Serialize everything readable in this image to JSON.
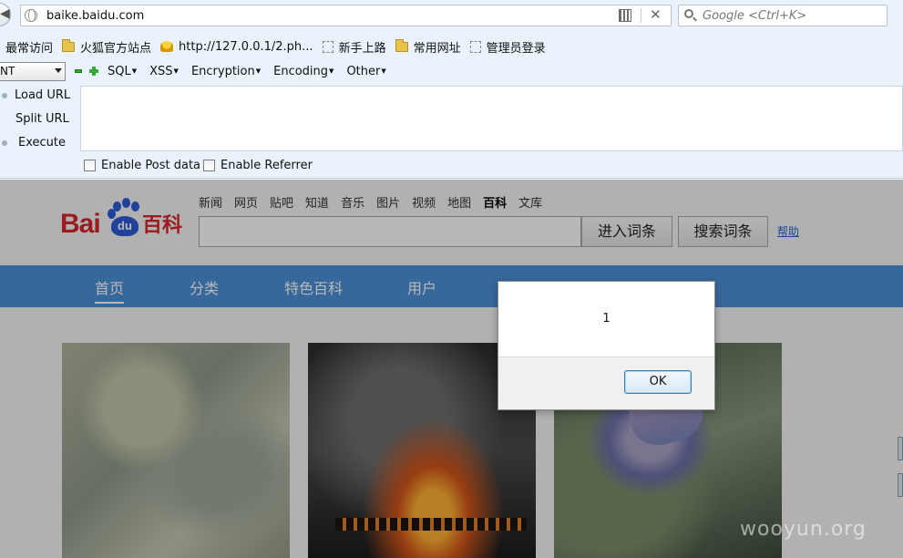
{
  "browser": {
    "url_host": "baike.baidu.com",
    "search_placeholder": "Google <Ctrl+K>",
    "bookmarks": [
      "最常访问",
      "火狐官方站点",
      "http://127.0.0.1/2.ph...",
      "新手上路",
      "常用网址",
      "管理员登录"
    ]
  },
  "hackbar": {
    "select_value": "NT",
    "menus": [
      "SQL",
      "XSS",
      "Encryption",
      "Encoding",
      "Other"
    ],
    "actions": [
      "Load URL",
      "Split URL",
      "Execute"
    ],
    "url_value": "",
    "checkboxes": [
      "Enable Post data",
      "Enable Referrer"
    ]
  },
  "baike": {
    "logo_bai": "Bai",
    "logo_du": "du",
    "logo_baike": "百科",
    "nav_links": [
      "新闻",
      "网页",
      "贴吧",
      "知道",
      "音乐",
      "图片",
      "视频",
      "地图",
      "百科",
      "文库"
    ],
    "active_link": "百科",
    "search_value": "",
    "enter_button": "进入词条",
    "search_button": "搜索词条",
    "help_link": "帮助",
    "tabs": [
      "首页",
      "分类",
      "特色百科",
      "用户"
    ],
    "watermark": "wooyun.org"
  },
  "dialog": {
    "message": "1",
    "ok_label": "OK"
  },
  "colors": {
    "nav_blue": "#4d90d8",
    "brand_red": "#d9262a",
    "brand_blue": "#2e5bd6"
  }
}
